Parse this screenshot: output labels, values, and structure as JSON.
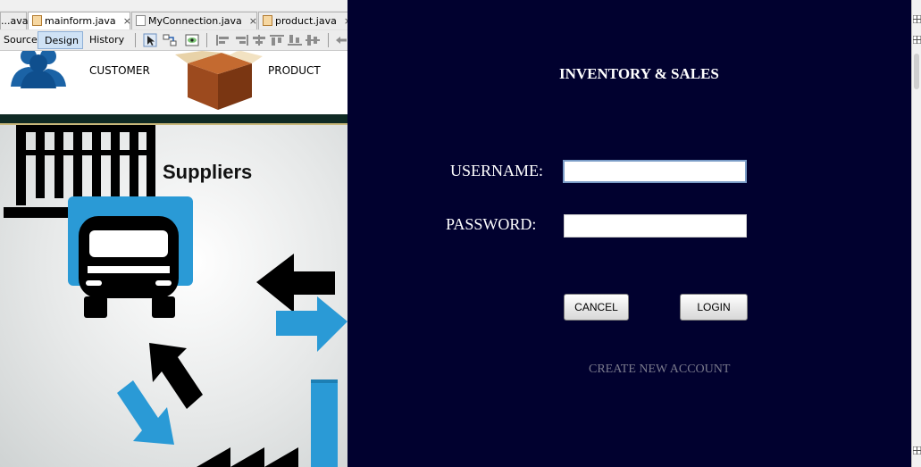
{
  "editor_tabs": [
    {
      "label": "...ava"
    },
    {
      "label": "mainform.java",
      "close": "×"
    },
    {
      "label": "MyConnection.java",
      "close": "×"
    },
    {
      "label": "product.java",
      "close": "×"
    }
  ],
  "view_switcher": {
    "source": "Source",
    "design": "Design",
    "history": "History"
  },
  "form_preview": {
    "customer_label": "CUSTOMER",
    "product_label": "PRODUCT",
    "suppliers_title": "Suppliers"
  },
  "login": {
    "title": "INVENTORY & SALES",
    "username_label": "USERNAME:",
    "password_label": "PASSWORD:",
    "username_value": "",
    "password_value": "",
    "cancel_label": "CANCEL",
    "login_label": "LOGIN",
    "create_account_label": "CREATE NEW ACCOUNT"
  },
  "colors": {
    "login_background": "#01012f",
    "suppliers_blue": "#2a9ad6",
    "ide_panel": "#f0f0f0"
  },
  "icons": [
    "java-file-icon",
    "gui-form-icon",
    "selection-mode-icon",
    "connection-mode-icon",
    "preview-design-icon",
    "align-icons",
    "customer-icon",
    "product-box-icon",
    "warehouse-icon",
    "truck-icon",
    "arrow-icons"
  ]
}
